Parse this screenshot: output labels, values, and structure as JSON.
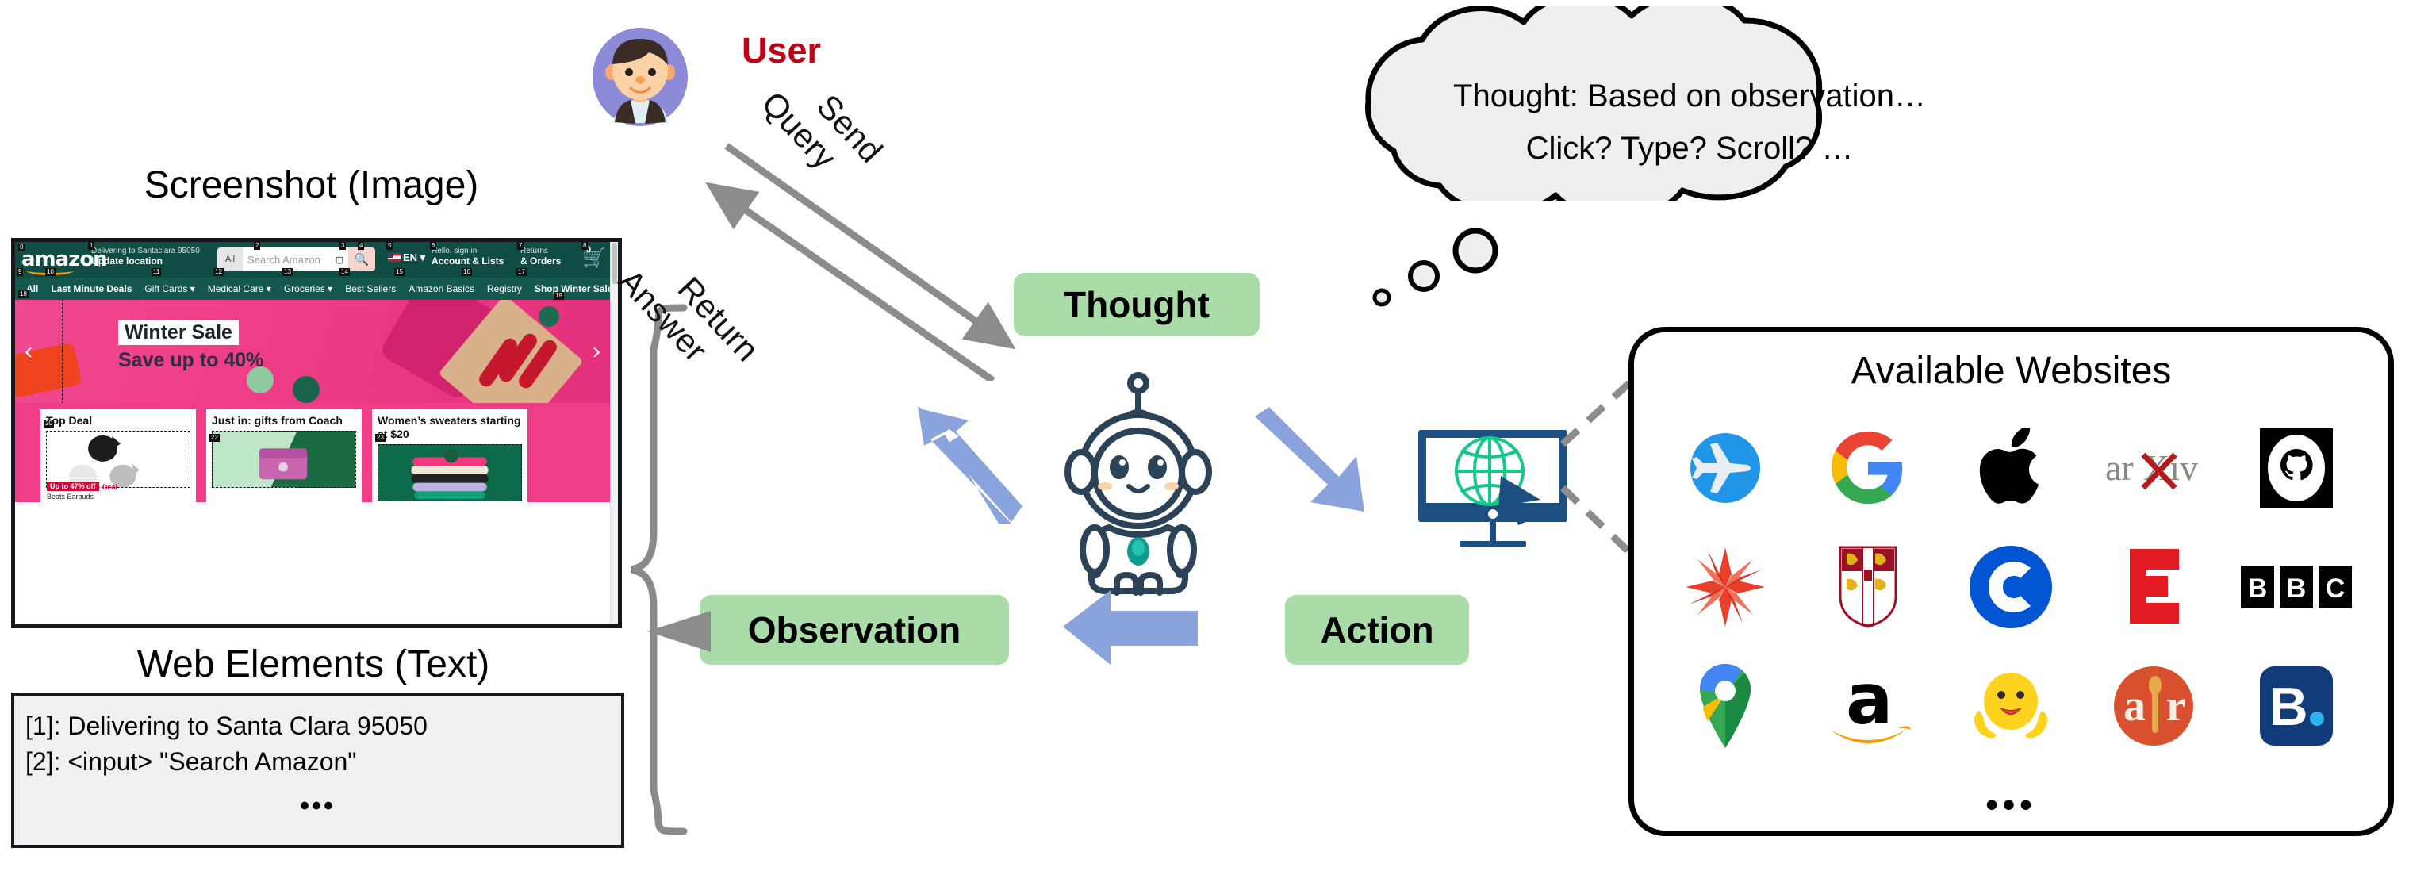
{
  "left_panel": {
    "screenshot_caption": "Screenshot (Image)",
    "webelements_caption": "Web Elements (Text)",
    "web_elements": {
      "lines": [
        "[1]: Delivering to Santa Clara 95050",
        "[2]: <input> \"Search Amazon\""
      ],
      "ellipsis": "•••"
    },
    "amazon": {
      "logo": "amazon",
      "delivering_small": "Delivering to Santaclara 95050",
      "delivering_bold": "Update location",
      "search_scope": "All",
      "search_placeholder": "Search Amazon",
      "camera_icon": "camera-icon",
      "search_icon": "search-icon",
      "language": "EN",
      "account_small": "Hello, sign in",
      "account_bold": "Account & Lists",
      "returns_small": "Returns",
      "returns_bold": "& Orders",
      "cart_count": "0",
      "nav_items": [
        "All",
        "Last Minute Deals",
        "Gift Cards ▾",
        "Medical Care ▾",
        "Groceries ▾",
        "Best Sellers",
        "Amazon Basics",
        "Registry",
        "Shop Winter Sale"
      ],
      "hero_title": "Winter Sale",
      "hero_sub": "Save up to 40%",
      "cards": [
        {
          "title": "Top Deal",
          "badge": "Up to 47% off",
          "badge2": "Deal",
          "sub": "Beats Earbuds"
        },
        {
          "title": "Just in: gifts from Coach",
          "badge": "",
          "badge2": "",
          "sub": ""
        },
        {
          "title": "Women’s sweaters starting at $20",
          "badge": "",
          "badge2": "",
          "sub": ""
        }
      ],
      "element_numbers": [
        "0",
        "1",
        "2",
        "3",
        "4",
        "5",
        "6",
        "7",
        "8",
        "9",
        "10",
        "11",
        "12",
        "13",
        "14",
        "15",
        "16",
        "17",
        "18",
        "19",
        "20",
        "22",
        "23"
      ]
    }
  },
  "user": {
    "label": "User",
    "label_color": "#c00014",
    "avatar_icon": "user-avatar-icon"
  },
  "flow": {
    "send_query": "Send\nQuery",
    "send_query_line1": "Send",
    "send_query_line2": "Query",
    "return_answer_line1": "Return",
    "return_answer_line2": "Answer"
  },
  "thought_cloud": {
    "line1": "Thought: Based on observation…",
    "line2": "Click? Type? Scroll? …"
  },
  "pills": {
    "thought": "Thought",
    "observation": "Observation",
    "action": "Action",
    "color": "#a9dca9"
  },
  "agent": {
    "robot_icon": "robot-agent-icon",
    "browser_icon": "browser-globe-monitor-icon"
  },
  "websites": {
    "title": "Available Websites",
    "ellipsis": "•••",
    "logos": [
      {
        "name": "flights-icon",
        "label": "Flights"
      },
      {
        "name": "google-icon",
        "label": "Google"
      },
      {
        "name": "apple-icon",
        "label": "Apple"
      },
      {
        "name": "arxiv-icon",
        "label": "arXiv"
      },
      {
        "name": "github-icon",
        "label": "GitHub"
      },
      {
        "name": "wolframalpha-icon",
        "label": "Wolfram Alpha"
      },
      {
        "name": "cambridge-dictionary-icon",
        "label": "Cambridge Dictionary"
      },
      {
        "name": "coursera-icon",
        "label": "Coursera"
      },
      {
        "name": "espn-icon",
        "label": "ESPN"
      },
      {
        "name": "bbc-icon",
        "label": "BBC"
      },
      {
        "name": "google-maps-icon",
        "label": "Google Maps"
      },
      {
        "name": "amazon-icon",
        "label": "Amazon"
      },
      {
        "name": "huggingface-icon",
        "label": "Hugging Face"
      },
      {
        "name": "allrecipes-icon",
        "label": "Allrecipes"
      },
      {
        "name": "booking-icon",
        "label": "Booking.com"
      }
    ]
  }
}
